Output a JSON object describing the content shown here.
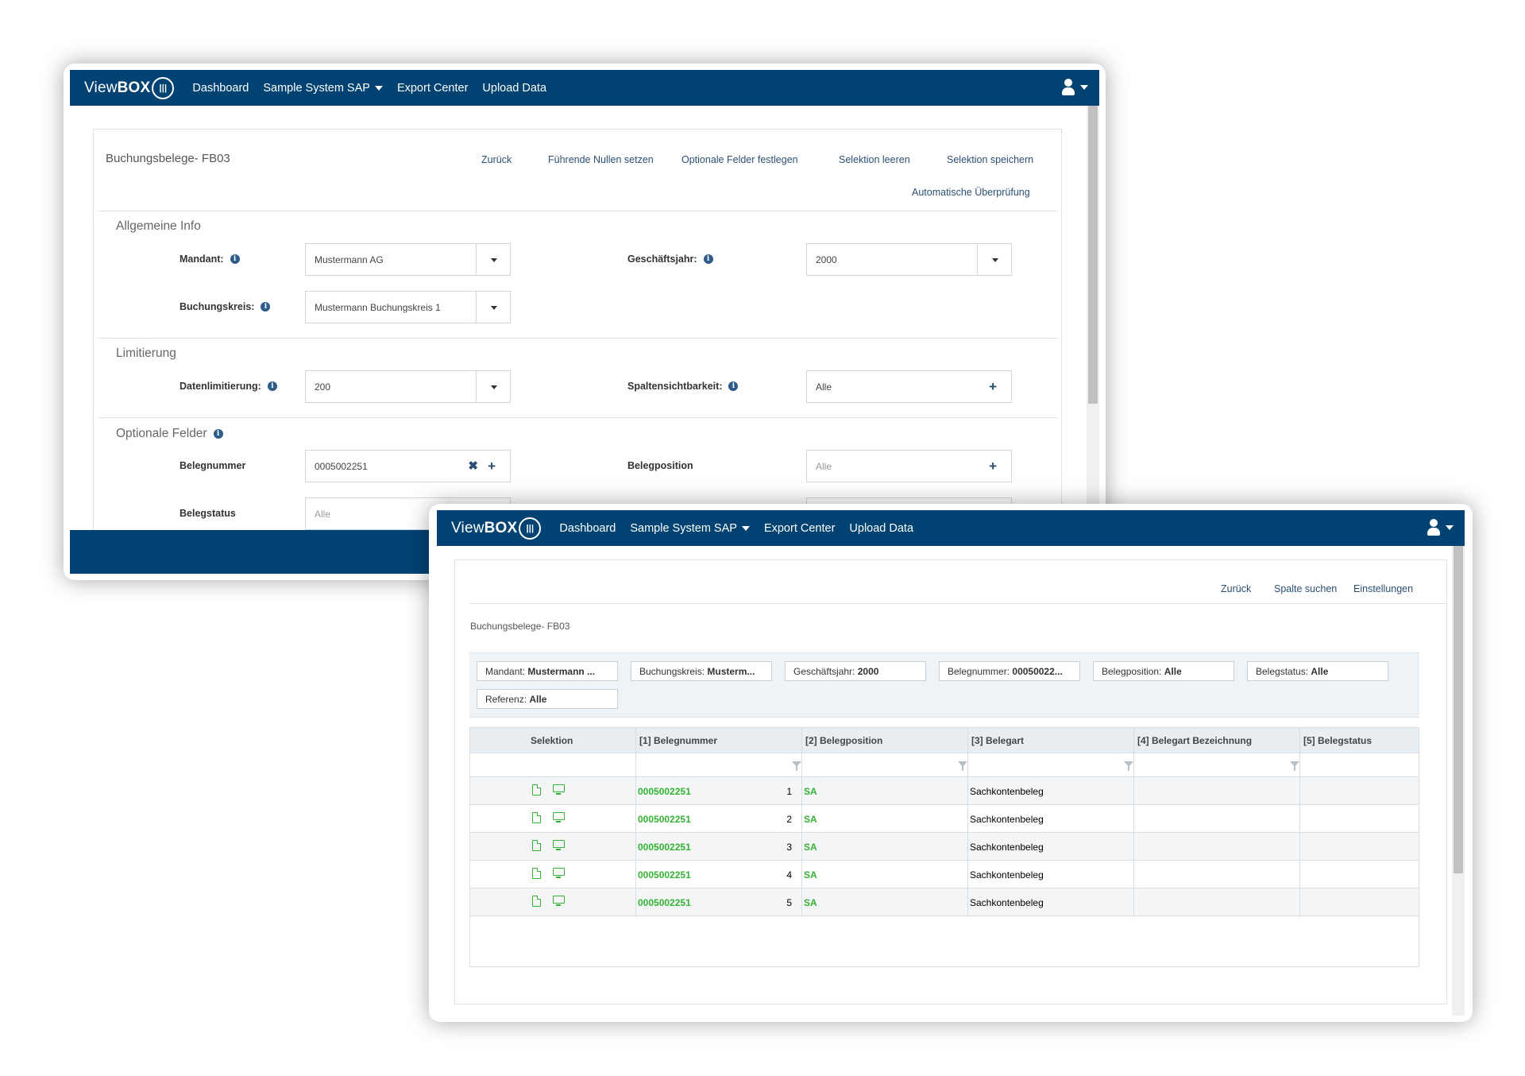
{
  "nav": {
    "brand_light": "View",
    "brand_bold": "BOX",
    "items": [
      "Dashboard",
      "Sample System SAP",
      "Export Center",
      "Upload Data"
    ]
  },
  "form": {
    "title": "Buchungsbelege- FB03",
    "actions": [
      "Zurück",
      "Führende Nullen setzen",
      "Optionale Felder festlegen",
      "Selektion leeren",
      "Selektion speichern",
      "Automatische Überprüfung"
    ],
    "sections": {
      "allgemeine": "Allgemeine Info",
      "limitierung": "Limitierung",
      "optionale": "Optionale Felder"
    },
    "fields": {
      "mandant_label": "Mandant:",
      "mandant_value": "Mustermann AG",
      "geschaeftsjahr_label": "Geschäftsjahr:",
      "geschaeftsjahr_value": "2000",
      "buchungskreis_label": "Buchungskreis:",
      "buchungskreis_value": "Mustermann Buchungskreis 1",
      "datenlimitierung_label": "Datenlimitierung:",
      "datenlimitierung_value": "200",
      "spaltensichtbarkeit_label": "Spaltensichtbarkeit:",
      "spaltensichtbarkeit_value": "Alle",
      "belegnummer_label": "Belegnummer",
      "belegnummer_value": "0005002251",
      "belegposition_label": "Belegposition",
      "belegposition_placeholder": "Alle",
      "belegstatus_label": "Belegstatus",
      "belegstatus_placeholder": "Alle"
    }
  },
  "results": {
    "actions": [
      "Zurück",
      "Spalte suchen",
      "Einstellungen"
    ],
    "title": "Buchungsbelege- FB03",
    "chips": [
      {
        "key": "Mandant:",
        "value": "Mustermann ..."
      },
      {
        "key": "Buchungskreis:",
        "value": "Musterm..."
      },
      {
        "key": "Geschäftsjahr:",
        "value": "2000"
      },
      {
        "key": "Belegnummer:",
        "value": "00050022..."
      },
      {
        "key": "Belegposition:",
        "value": "Alle"
      },
      {
        "key": "Belegstatus:",
        "value": "Alle"
      },
      {
        "key": "Referenz:",
        "value": "Alle"
      }
    ],
    "columns": [
      "Selektion",
      "[1] Belegnummer",
      "[2] Belegposition",
      "[3] Belegart",
      "[4] Belegart Bezeichnung",
      "[5] Belegstatus"
    ],
    "rows": [
      {
        "belegnummer": "0005002251",
        "position": "1",
        "belegart": "SA",
        "bezeichnung": "Sachkontenbeleg",
        "status": ""
      },
      {
        "belegnummer": "0005002251",
        "position": "2",
        "belegart": "SA",
        "bezeichnung": "Sachkontenbeleg",
        "status": ""
      },
      {
        "belegnummer": "0005002251",
        "position": "3",
        "belegart": "SA",
        "bezeichnung": "Sachkontenbeleg",
        "status": ""
      },
      {
        "belegnummer": "0005002251",
        "position": "4",
        "belegart": "SA",
        "bezeichnung": "Sachkontenbeleg",
        "status": ""
      },
      {
        "belegnummer": "0005002251",
        "position": "5",
        "belegart": "SA",
        "bezeichnung": "Sachkontenbeleg",
        "status": ""
      }
    ]
  },
  "colors": {
    "navbar": "#004373",
    "link": "#2b4f73",
    "green": "#34b233"
  }
}
